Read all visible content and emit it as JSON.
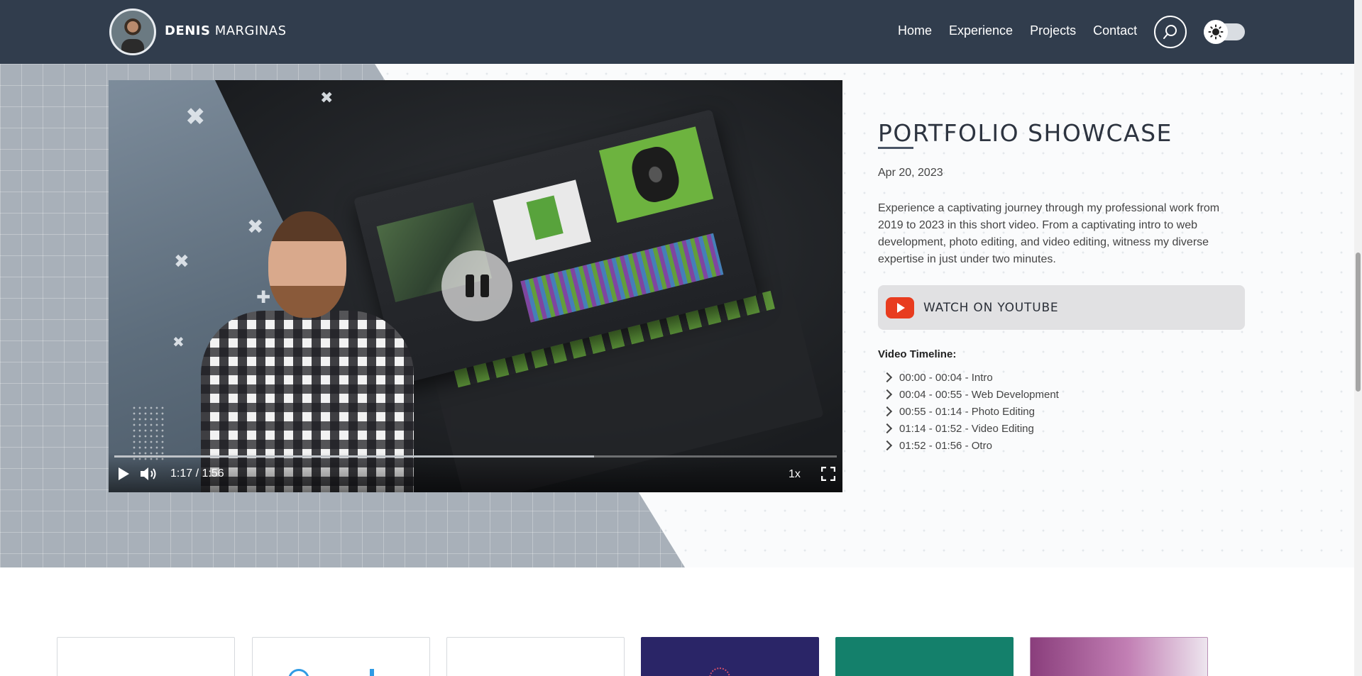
{
  "header": {
    "brand_first": "DENIS",
    "brand_last": "MARGINAS",
    "nav": [
      "Home",
      "Experience",
      "Projects",
      "Contact"
    ],
    "search_icon": "search-icon",
    "theme_icon": "sun-icon"
  },
  "video": {
    "time": "1:17 / 1:56",
    "speed": "1x",
    "progress_fraction": 0.664,
    "state_icon": "pause-icon"
  },
  "showcase": {
    "title": "PORTFOLIO SHOWCASE",
    "date": "Apr 20, 2023",
    "description": "Experience a captivating journey through my professional work from 2019 to 2023 in this short video. From a captivating intro to web development, photo editing, and video editing, witness my diverse expertise in just under two minutes.",
    "youtube_label": "WATCH ON YOUTUBE",
    "timeline_heading": "Video Timeline:",
    "timeline": [
      "00:00 - 00:04 - Intro",
      "00:04 - 00:55 - Web Development",
      "00:55 - 01:14 - Photo Editing",
      "01:14 - 01:52 - Video Editing",
      "01:52 - 01:56 - Otro"
    ]
  },
  "colors": {
    "header_bg": "#313d4d",
    "youtube_red": "#e83c1f",
    "button_bg": "#e1e1e3"
  }
}
